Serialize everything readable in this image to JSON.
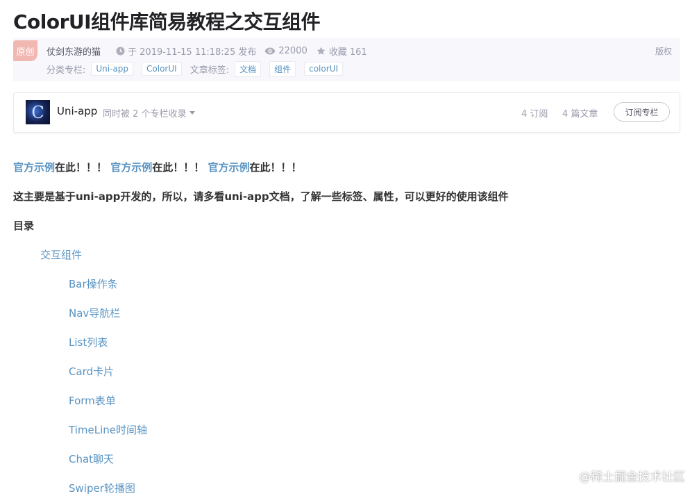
{
  "article": {
    "title": "ColorUI组件库简易教程之交互组件",
    "original_badge": "原创",
    "author": "仗剑东游的猫",
    "publish_time": "于 2019-11-15 11:18:25 发布",
    "views": "22000",
    "favorites": "收藏 161",
    "copyright": "版权",
    "category_label": "分类专栏:",
    "categories": [
      "Uni-app",
      "ColorUI"
    ],
    "tags_label": "文章标签:",
    "tags": [
      "文档",
      "组件",
      "colorUI"
    ]
  },
  "column": {
    "avatar_letter": "C",
    "name": "Uni-app",
    "included_text": "同时被 2 个专栏收录",
    "subscribers": "4 订阅",
    "articles": "4 篇文章",
    "subscribe_button": "订阅专栏"
  },
  "body": {
    "notice": {
      "link1": "官方示例",
      "text1": "在此！！！ ",
      "link2": "官方示例",
      "text2": "在此！！！ ",
      "link3": "官方示例",
      "text3": "在此！！！"
    },
    "intro": "这主要是基于uni-app开发的，所以，请多看uni-app文档，了解一些标签、属性，可以更好的使用该组件",
    "toc_heading": "目录",
    "toc_root": "交互组件",
    "toc_items": [
      "Bar操作条",
      "Nav导航栏",
      "List列表",
      "Card卡片",
      "Form表单",
      "TimeLine时间轴",
      "Chat聊天",
      "Swiper轮播图"
    ]
  },
  "watermark": "@稀土掘金技术社区",
  "icons": {
    "clock": "clock-icon",
    "eye": "eye-icon",
    "star": "star-icon"
  }
}
